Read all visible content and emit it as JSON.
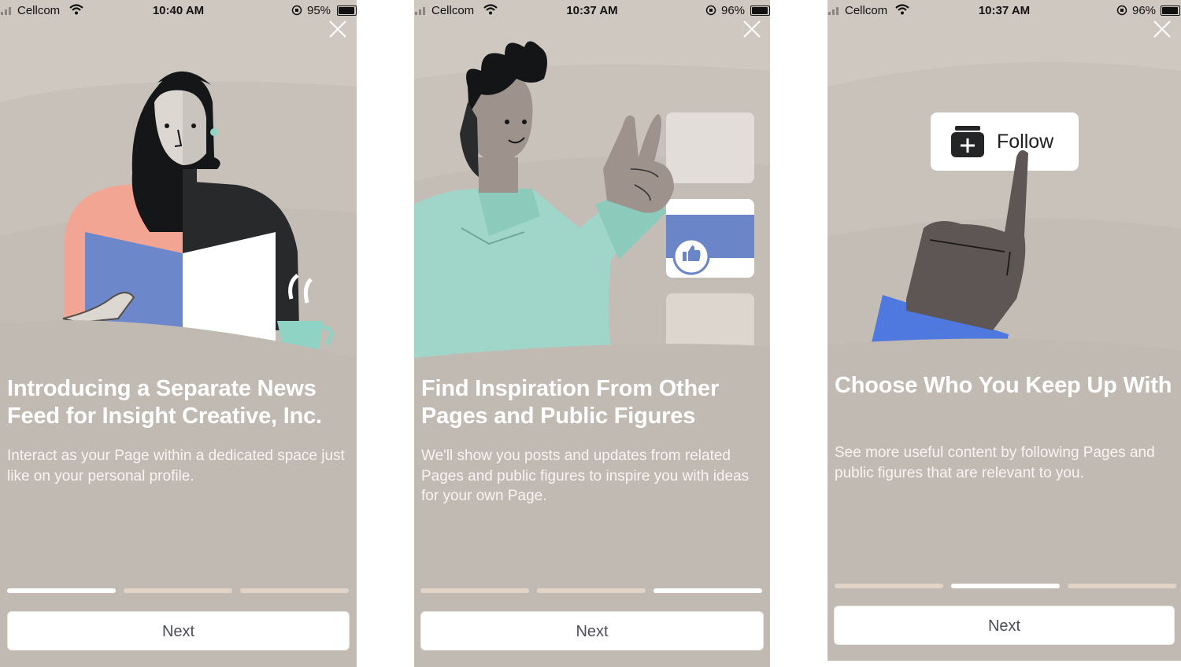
{
  "screens": [
    {
      "status": {
        "carrier": "Cellcom",
        "time": "10:40 AM",
        "battery": "95%",
        "battery_level": 0.95
      },
      "title": "Introducing a Separate News Feed for Insight Creative, Inc.",
      "description": "Interact as your Page within a dedicated space just like on your personal profile.",
      "progress": {
        "total": 3,
        "active": 1
      },
      "next_label": "Next"
    },
    {
      "status": {
        "carrier": "Cellcom",
        "time": "10:37 AM",
        "battery": "96%",
        "battery_level": 0.96
      },
      "title": "Find Inspiration From Other Pages and Public Figures",
      "description": "We'll show you posts and updates from related Pages and public figures to inspire you with ideas for your own Page.",
      "progress": {
        "total": 3,
        "active": 3
      },
      "next_label": "Next"
    },
    {
      "status": {
        "carrier": "Cellcom",
        "time": "10:37 AM",
        "battery": "96%",
        "battery_level": 0.96
      },
      "follow_label": "Follow",
      "title": "Choose Who You Keep Up With",
      "description": "See more useful content by following Pages and public figures that are relevant to you.",
      "progress": {
        "total": 3,
        "active": 2
      },
      "next_label": "Next"
    }
  ],
  "icons": {
    "close": "close-icon",
    "signal": "signal-bars-icon",
    "wifi": "wifi-icon",
    "orientation_lock": "orientation-lock-icon",
    "battery": "battery-icon",
    "thumbs_up": "thumbs-up-icon",
    "follow": "follow-icon"
  },
  "colors": {
    "background": "#c1bab3",
    "button": "#ffffff",
    "progress_active": "#ffffff",
    "progress_inactive": "#e1d4c7",
    "facebook_blue": "#6a86c8",
    "mint": "#9fd6c9",
    "coral": "#f2a592"
  }
}
